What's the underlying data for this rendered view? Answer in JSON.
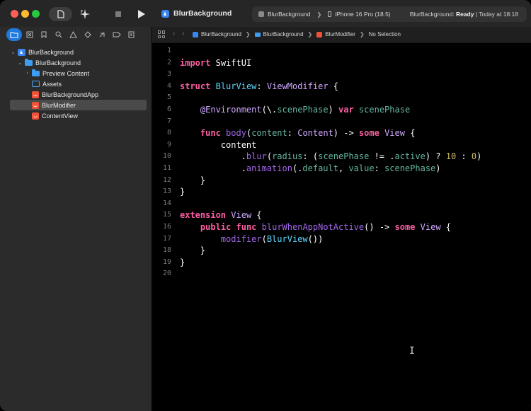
{
  "window": {
    "app_title": "BlurBackground",
    "scheme": "BlurBackground",
    "destination": "iPhone 16 Pro (18.5)",
    "status_prefix": "BlurBackground: ",
    "status_state": "Ready",
    "status_suffix": " | Today at 18:18"
  },
  "navigator": {
    "items": [
      {
        "label": "BlurBackground",
        "icon": "project-icon"
      },
      {
        "label": "BlurBackground",
        "icon": "folder-icon"
      },
      {
        "label": "Preview Content",
        "icon": "folder-icon"
      },
      {
        "label": "Assets",
        "icon": "assets-icon"
      },
      {
        "label": "BlurBackgroundApp",
        "icon": "swift-file-icon"
      },
      {
        "label": "BlurModifier",
        "icon": "swift-file-icon"
      },
      {
        "label": "ContentView",
        "icon": "swift-file-icon"
      }
    ]
  },
  "breadcrumb": {
    "project": "BlurBackground",
    "folder": "BlurBackground",
    "file": "BlurModifier",
    "selection": "No Selection"
  },
  "editor": {
    "line_numbers": [
      "1",
      "2",
      "3",
      "4",
      "5",
      "6",
      "7",
      "8",
      "9",
      "10",
      "11",
      "12",
      "13",
      "14",
      "15",
      "16",
      "17",
      "18",
      "19",
      "20"
    ],
    "code_lines": [
      "",
      "import SwiftUI",
      "",
      "struct BlurView: ViewModifier {",
      "",
      "    @Environment(\\.scenePhase) var scenePhase",
      "",
      "    func body(content: Content) -> some View {",
      "        content",
      "            .blur(radius: (scenePhase != .active) ? 10 : 0)",
      "            .animation(.default, value: scenePhase)",
      "    }",
      "}",
      "",
      "extension View {",
      "    public func blurWhenAppNotActive() -> some View {",
      "        modifier(BlurView())",
      "    }",
      "}",
      ""
    ]
  }
}
